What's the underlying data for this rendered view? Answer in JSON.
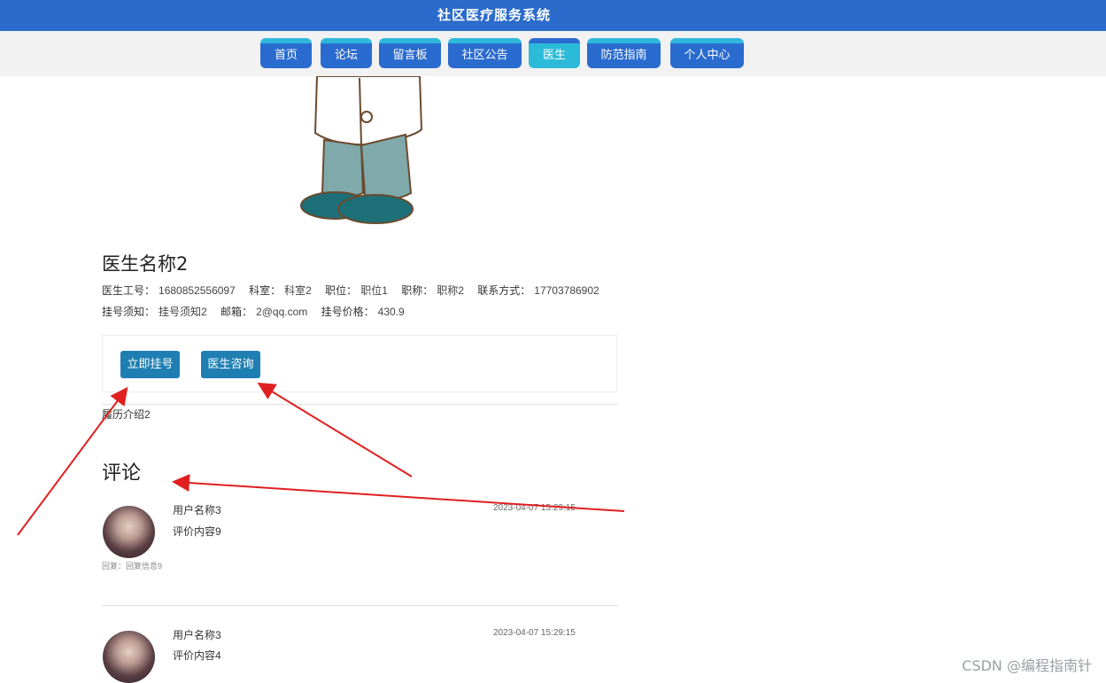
{
  "header": {
    "title": "社区医疗服务系统"
  },
  "nav": {
    "items": [
      {
        "label": "首页"
      },
      {
        "label": "论坛"
      },
      {
        "label": "留言板"
      },
      {
        "label": "社区公告"
      },
      {
        "label": "医生"
      },
      {
        "label": "防范指南"
      },
      {
        "label": "个人中心"
      }
    ],
    "active": "医生"
  },
  "doctor": {
    "name": "医生名称2",
    "fields_line1": [
      {
        "label": "医生工号：",
        "value": "1680852556097"
      },
      {
        "label": "科室：",
        "value": "科室2"
      },
      {
        "label": "职位：",
        "value": "职位1"
      },
      {
        "label": "职称：",
        "value": "职称2"
      },
      {
        "label": "联系方式：",
        "value": "17703786902"
      }
    ],
    "fields_line2": [
      {
        "label": "挂号须知：",
        "value": "挂号须知2"
      },
      {
        "label": "邮箱：",
        "value": "2@qq.com"
      },
      {
        "label": "挂号价格：",
        "value": "430.9"
      }
    ],
    "intro": "履历介绍2"
  },
  "actions": {
    "register_label": "立即挂号",
    "consult_label": "医生咨询"
  },
  "comments": {
    "heading": "评论",
    "items": [
      {
        "user": "用户名称3",
        "content": "评价内容9",
        "time": "2023-04-07 15:29:15",
        "reply": "回复：回复信息9"
      },
      {
        "user": "用户名称3",
        "content": "评价内容4",
        "time": "2023-04-07 15:29:15"
      }
    ]
  },
  "watermark": "CSDN @编程指南针",
  "colors": {
    "header_bg": "#2b6bcb",
    "nav_bg": "#2a6bcf",
    "nav_active_bg": "#2bbbd8",
    "button_bg": "#1f7fb3",
    "annotation_arrow": "#e02020"
  }
}
